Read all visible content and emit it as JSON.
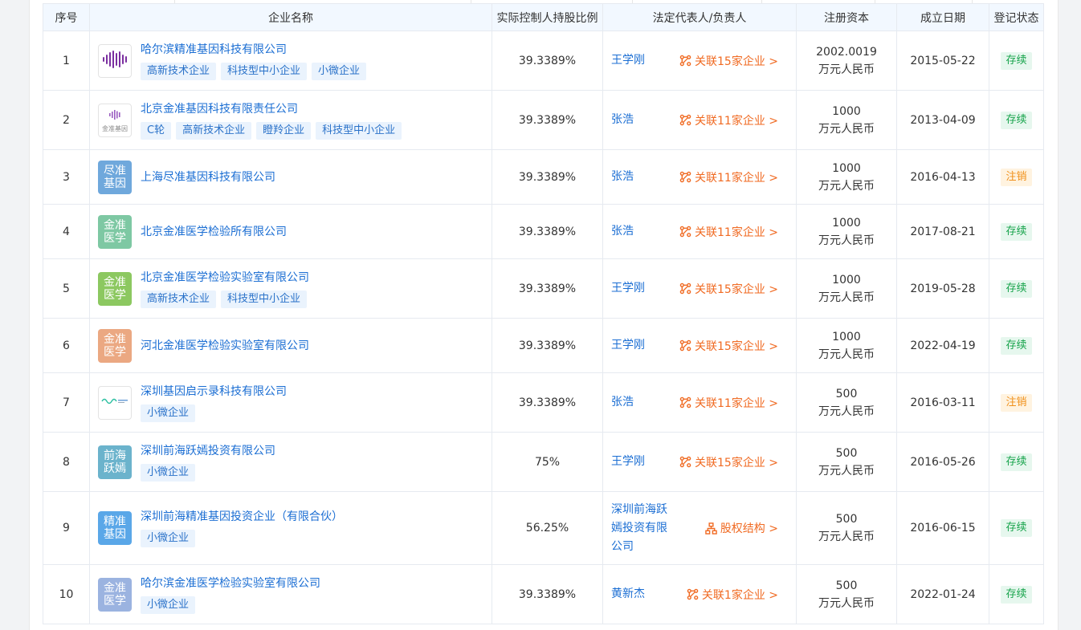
{
  "headers": {
    "index": "序号",
    "name": "企业名称",
    "ratio": "实际控制人持股比例",
    "rep": "法定代表人/负责人",
    "capital": "注册资本",
    "date": "成立日期",
    "status": "登记状态"
  },
  "colors": {
    "link": "#1b6ed3",
    "related": "#f06a22",
    "status_ok": "#15a34a",
    "status_off": "#f0901a"
  },
  "rows": [
    {
      "index": "1",
      "logo": "image",
      "logo_icon": "waveform-logo-icon",
      "name": "哈尔滨精准基因科技有限公司",
      "tags": [
        "高新技术企业",
        "科技型中小企业",
        "小微企业"
      ],
      "ratio": "39.3389%",
      "rep": "王学刚",
      "related": "关联15家企业 >",
      "related_icon": "network-icon",
      "cap1": "2002.0019",
      "cap2": "万元人民币",
      "date": "2015-05-22",
      "status": "存续",
      "status_type": "ok"
    },
    {
      "index": "2",
      "logo": "image",
      "logo_icon": "jinzhun-gene-logo-icon",
      "logo_caption": "金准基因",
      "name": "北京金准基因科技有限责任公司",
      "tags": [
        "C轮",
        "高新技术企业",
        "瞪羚企业",
        "科技型中小企业"
      ],
      "ratio": "39.3389%",
      "rep": "张浩",
      "related": "关联11家企业 >",
      "related_icon": "network-icon",
      "cap1": "1000",
      "cap2": "万元人民币",
      "date": "2013-04-09",
      "status": "存续",
      "status_type": "ok"
    },
    {
      "index": "3",
      "logo": "text",
      "logo_text": "尽准基因",
      "logo_color": "#6fa8dc",
      "name": "上海尽准基因科技有限公司",
      "tags": [],
      "ratio": "39.3389%",
      "rep": "张浩",
      "related": "关联11家企业 >",
      "related_icon": "network-icon",
      "cap1": "1000",
      "cap2": "万元人民币",
      "date": "2016-04-13",
      "status": "注销",
      "status_type": "off"
    },
    {
      "index": "4",
      "logo": "text",
      "logo_text": "金准医学",
      "logo_color": "#7ec8a3",
      "name": "北京金准医学检验所有限公司",
      "tags": [],
      "ratio": "39.3389%",
      "rep": "张浩",
      "related": "关联11家企业 >",
      "related_icon": "network-icon",
      "cap1": "1000",
      "cap2": "万元人民币",
      "date": "2017-08-21",
      "status": "存续",
      "status_type": "ok"
    },
    {
      "index": "5",
      "logo": "text",
      "logo_text": "金准医学",
      "logo_color": "#8cc860",
      "name": "北京金准医学检验实验室有限公司",
      "tags": [
        "高新技术企业",
        "科技型中小企业"
      ],
      "ratio": "39.3389%",
      "rep": "王学刚",
      "related": "关联15家企业 >",
      "related_icon": "network-icon",
      "cap1": "1000",
      "cap2": "万元人民币",
      "date": "2019-05-28",
      "status": "存续",
      "status_type": "ok"
    },
    {
      "index": "6",
      "logo": "text",
      "logo_text": "金准医学",
      "logo_color": "#eba882",
      "name": "河北金准医学检验实验室有限公司",
      "tags": [],
      "ratio": "39.3389%",
      "rep": "王学刚",
      "related": "关联15家企业 >",
      "related_icon": "network-icon",
      "cap1": "1000",
      "cap2": "万元人民币",
      "date": "2022-04-19",
      "status": "存续",
      "status_type": "ok"
    },
    {
      "index": "7",
      "logo": "image",
      "logo_icon": "wave-line-logo-icon",
      "name": "深圳基因启示录科技有限公司",
      "tags": [
        "小微企业"
      ],
      "ratio": "39.3389%",
      "rep": "张浩",
      "related": "关联11家企业 >",
      "related_icon": "network-icon",
      "cap1": "500",
      "cap2": "万元人民币",
      "date": "2016-03-11",
      "status": "注销",
      "status_type": "off"
    },
    {
      "index": "8",
      "logo": "text",
      "logo_text": "前海跃嫣",
      "logo_color": "#6bb3cc",
      "name": "深圳前海跃嫣投资有限公司",
      "tags": [
        "小微企业"
      ],
      "ratio": "75%",
      "rep": "王学刚",
      "related": "关联15家企业 >",
      "related_icon": "network-icon",
      "cap1": "500",
      "cap2": "万元人民币",
      "date": "2016-05-26",
      "status": "存续",
      "status_type": "ok"
    },
    {
      "index": "9",
      "logo": "text",
      "logo_text": "精准基因",
      "logo_color": "#5aa7e8",
      "name": "深圳前海精准基因投资企业（有限合伙）",
      "tags": [
        "小微企业"
      ],
      "ratio": "56.25%",
      "rep": "深圳前海跃嫣投资有限公司",
      "related": "股权结构 >",
      "related_icon": "equity-structure-icon",
      "cap1": "500",
      "cap2": "万元人民币",
      "date": "2016-06-15",
      "status": "存续",
      "status_type": "ok"
    },
    {
      "index": "10",
      "logo": "text",
      "logo_text": "金准医学",
      "logo_color": "#9bb3e0",
      "name": "哈尔滨金准医学检验实验室有限公司",
      "tags": [
        "小微企业"
      ],
      "ratio": "39.3389%",
      "rep": "黄新杰",
      "related": "关联1家企业 >",
      "related_icon": "network-icon",
      "cap1": "500",
      "cap2": "万元人民币",
      "date": "2022-01-24",
      "status": "存续",
      "status_type": "ok"
    }
  ]
}
